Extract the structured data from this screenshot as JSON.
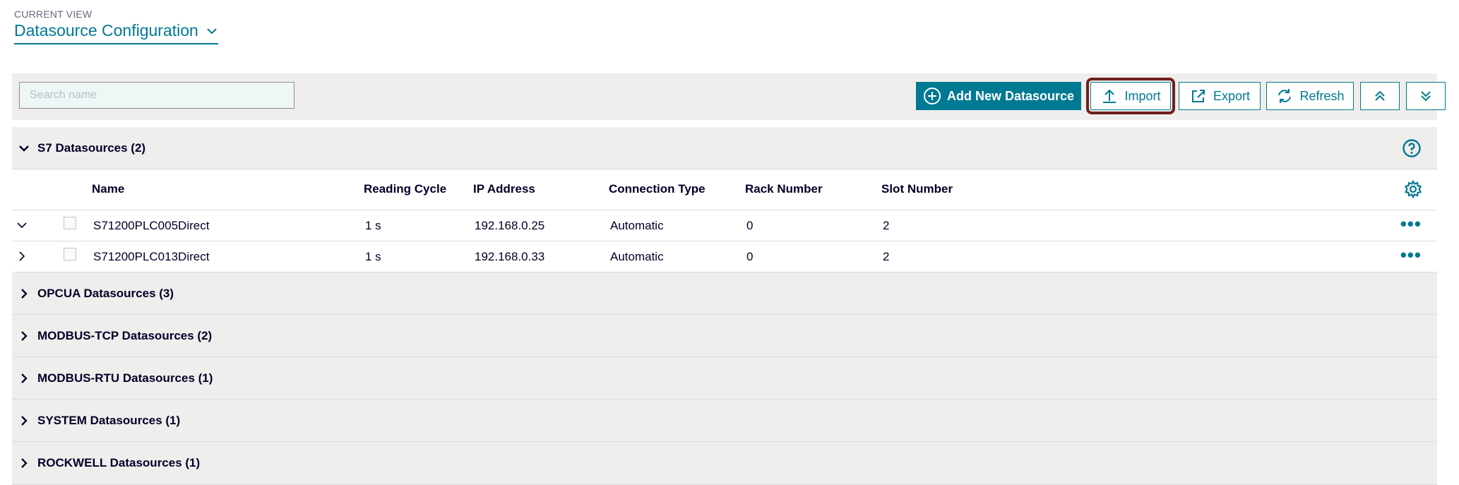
{
  "view": {
    "caption": "CURRENT VIEW",
    "title": "Datasource Configuration"
  },
  "toolbar": {
    "search_placeholder": "Search name",
    "add_label": "Add New Datasource",
    "import_label": "Import",
    "export_label": "Export",
    "refresh_label": "Refresh"
  },
  "groups": [
    {
      "label": "S7 Datasources (2)",
      "expanded": true
    },
    {
      "label": "OPCUA Datasources (3)",
      "expanded": false
    },
    {
      "label": "MODBUS-TCP Datasources (2)",
      "expanded": false
    },
    {
      "label": "MODBUS-RTU Datasources (1)",
      "expanded": false
    },
    {
      "label": "SYSTEM Datasources (1)",
      "expanded": false
    },
    {
      "label": "ROCKWELL Datasources (1)",
      "expanded": false
    }
  ],
  "table": {
    "columns": [
      "Name",
      "Reading Cycle",
      "IP Address",
      "Connection Type",
      "Rack Number",
      "Slot Number"
    ],
    "rows": [
      {
        "name": "S71200PLC005Direct",
        "cycle": "1 s",
        "ip": "192.168.0.25",
        "conn": "Automatic",
        "rack": "0",
        "slot": "2",
        "expanded": true
      },
      {
        "name": "S71200PLC013Direct",
        "cycle": "1 s",
        "ip": "192.168.0.33",
        "conn": "Automatic",
        "rack": "0",
        "slot": "2",
        "expanded": false
      }
    ],
    "more_label": "•••"
  },
  "colors": {
    "accent": "#007993",
    "panel": "#efeeec",
    "highlight": "#6e1f1f"
  }
}
